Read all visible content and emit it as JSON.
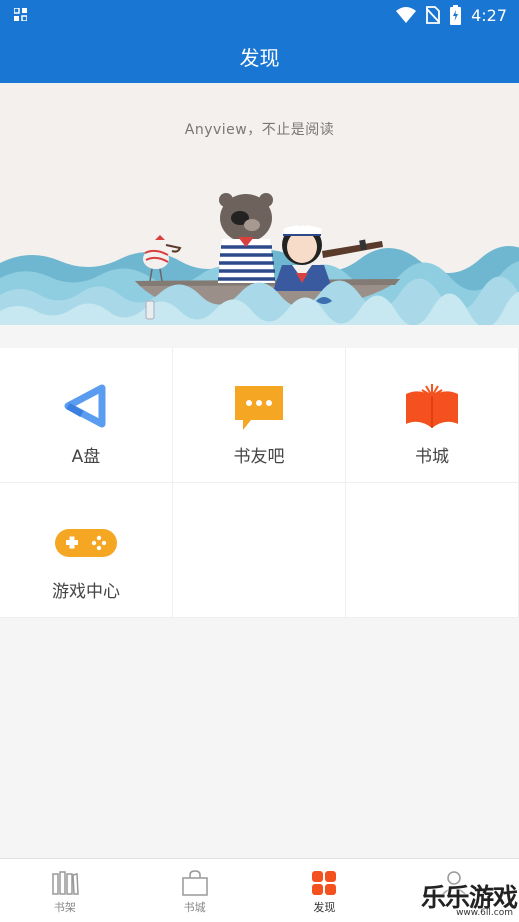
{
  "status_bar": {
    "time": "4:27"
  },
  "app_bar": {
    "title": "发现"
  },
  "banner": {
    "slogan": "Anyview，不止是阅读"
  },
  "grid_items": [
    {
      "label": "A盘",
      "icon": "a-disk-icon"
    },
    {
      "label": "书友吧",
      "icon": "chat-bubble-icon"
    },
    {
      "label": "书城",
      "icon": "open-book-icon"
    },
    {
      "label": "游戏中心",
      "icon": "gamepad-icon"
    }
  ],
  "bottom_nav": [
    {
      "label": "书架",
      "icon": "bookshelf-icon",
      "active": false
    },
    {
      "label": "书城",
      "icon": "shopping-bag-icon",
      "active": false
    },
    {
      "label": "发现",
      "icon": "discover-grid-icon",
      "active": true
    },
    {
      "label": "",
      "icon": "profile-icon",
      "active": false
    }
  ],
  "watermark": {
    "text": "乐乐游戏",
    "url": "www.6ll.com"
  },
  "colors": {
    "primary": "#1976d2",
    "orange": "#f5a623",
    "red_orange": "#f4511e",
    "active_nav": "#f4511e"
  }
}
